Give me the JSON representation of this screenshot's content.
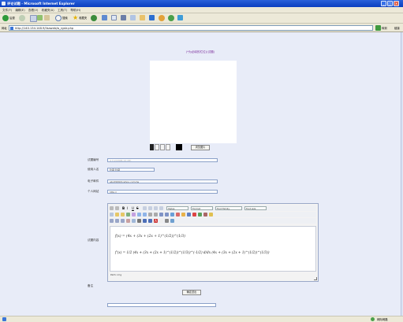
{
  "window": {
    "title": "评论试题 - Microsoft Internet Explorer"
  },
  "menu": [
    "文件(F)",
    "编辑(E)",
    "查看(V)",
    "收藏夹(A)",
    "工具(T)",
    "帮助(H)"
  ],
  "toolbar": {
    "back": "后退",
    "search": "搜索",
    "favorites": "收藏夹"
  },
  "address": {
    "url": "http://140.134.148.9/Ilsaweb/w_rgstr.php",
    "go": "转到",
    "links": "链接"
  },
  "page": {
    "heading": "(*为必填的栏位)(试题)",
    "upload_button": "浏览图片",
    "form": {
      "id_label": "试题编号",
      "id_value": "4 3 2(2006-12-28)",
      "name_label": "使用人名",
      "name_value": "隐藏 隐藏",
      "email_label": "电子邮件",
      "email_value": "abcd999@yahoo.com.tw",
      "site_label": "个人网站",
      "site_value": "http://",
      "content_label": "试题内容",
      "note_label": "备注",
      "submit": "确定送出"
    },
    "editor": {
      "styles": "Styles",
      "format": "Format",
      "font": "Font Family",
      "size": "Font size",
      "path": "Path: img",
      "formula1": "f(x) = (4x + (3x + (2x + 1)^(1/2))^(1/3)",
      "formula2": "f'(x) = 1/2 (4x + (3x + (2x + 1)^(1/2))^(1/3))^(-1/2) d/dx (4x + (3x + (2x + 1)^(1/2))^(1/3))"
    }
  },
  "status": {
    "zone": "网际网路"
  }
}
